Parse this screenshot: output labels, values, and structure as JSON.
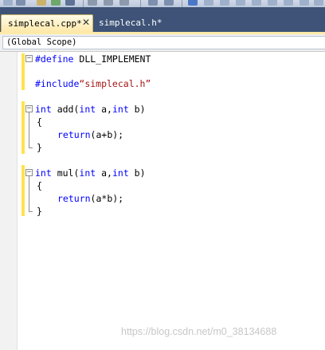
{
  "tabs": [
    {
      "label": "simplecal.cpp*",
      "active": true
    },
    {
      "label": "simplecal.h*",
      "active": false
    }
  ],
  "tab_close_glyph": "✕",
  "scope": {
    "label": "(Global Scope)"
  },
  "code": {
    "line1": {
      "directive": "#define",
      "rest": " DLL_IMPLEMENT"
    },
    "line2": {
      "directive": "#include",
      "string": "“simplecal.h”"
    },
    "line3": {
      "kw1": "int",
      "p1": " add(",
      "kw2": "int",
      "p2": " a,",
      "kw3": "int",
      "p3": " b)"
    },
    "line4": {
      "text": "{"
    },
    "line5": {
      "kw": "return",
      "rest": "(a+b);"
    },
    "line6": {
      "text": "}"
    },
    "line7": {
      "kw1": "int",
      "p1": " mul(",
      "kw2": "int",
      "p2": " a,",
      "kw3": "int",
      "p3": " b)"
    },
    "line8": {
      "text": "{"
    },
    "line9": {
      "kw": "return",
      "rest": "(a*b);"
    },
    "line10": {
      "text": "}"
    }
  },
  "fold_glyph": "−",
  "watermark": "https://blog.csdn.net/m0_38134688",
  "colors": {
    "keyword": "#0000ff",
    "string": "#a31515",
    "tab_bar": "#3e5377",
    "active_tab": "#ffe9a8",
    "change_bar": "#ffe34d"
  },
  "icons": [
    "close-icon",
    "fold-minus-icon"
  ]
}
